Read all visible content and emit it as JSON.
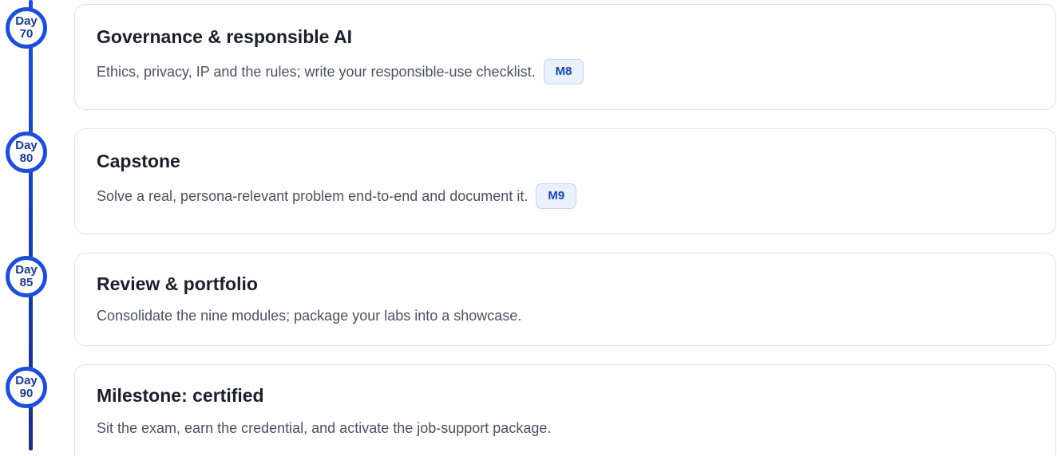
{
  "milestones": [
    {
      "day_label": "Day",
      "day_number": "70",
      "title": "Governance & responsible AI",
      "description": "Ethics, privacy, IP and the rules; write your responsible-use checklist.",
      "badge": "M8"
    },
    {
      "day_label": "Day",
      "day_number": "80",
      "title": "Capstone",
      "description": "Solve a real, persona-relevant problem end-to-end and document it.",
      "badge": "M9"
    },
    {
      "day_label": "Day",
      "day_number": "85",
      "title": "Review & portfolio",
      "description": "Consolidate the nine modules; package your labs into a showcase."
    },
    {
      "day_label": "Day",
      "day_number": "90",
      "title": "Milestone: certified",
      "description": "Sit the exam, earn the credential, and activate the job-support package."
    }
  ],
  "colors": {
    "rail": "#1f4fd6",
    "node_text": "#1a3a8f",
    "badge_bg": "#eaf1fd",
    "badge_text": "#1c46b0"
  }
}
